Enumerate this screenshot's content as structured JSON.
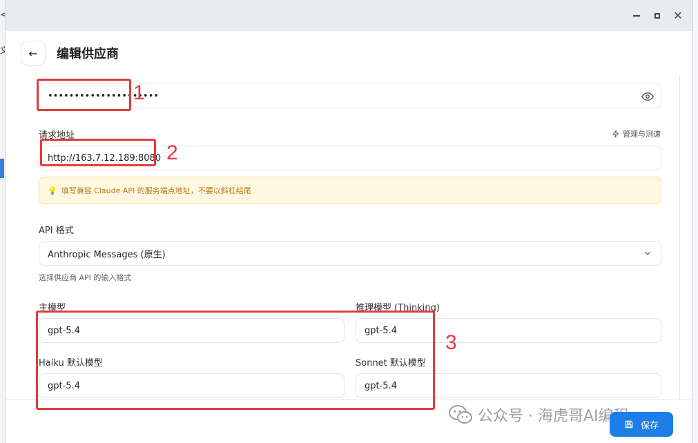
{
  "window": {
    "minimize_icon": "minimize-icon",
    "maximize_icon": "maximize-icon",
    "close_glyph": "✕"
  },
  "header": {
    "title": "编辑供应商",
    "back_glyph": "←"
  },
  "api_key": {
    "value": "•••••••••••••••••••••"
  },
  "request_url": {
    "label": "请求地址",
    "value": "http://163.7.12.189:8080",
    "manage_label": "管理与测速"
  },
  "tip": {
    "bulb": "💡",
    "text": "填写兼容 Claude API 的服务端点地址，不要以斜杠结尾"
  },
  "api_format": {
    "label": "API 格式",
    "value": "Anthropic Messages (原生)",
    "helper": "选择供应商 API 的输入格式"
  },
  "models": {
    "main_label": "主模型",
    "main_value": "gpt-5.4",
    "thinking_label": "推理模型 (Thinking)",
    "thinking_value": "gpt-5.4",
    "haiku_label": "Haiku 默认模型",
    "haiku_value": "gpt-5.4",
    "sonnet_label": "Sonnet 默认模型",
    "sonnet_value": "gpt-5.4"
  },
  "footer": {
    "save_label": "保存"
  },
  "annotations": {
    "n1": "1",
    "n2": "2",
    "n3": "3"
  },
  "watermark": {
    "text": "公众号 · 海虎哥AI编程"
  },
  "colors": {
    "accent": "#1e7ee8",
    "annotation": "#e23b3b",
    "tip_bg": "#fff8e1",
    "tip_text": "#b7791f"
  }
}
